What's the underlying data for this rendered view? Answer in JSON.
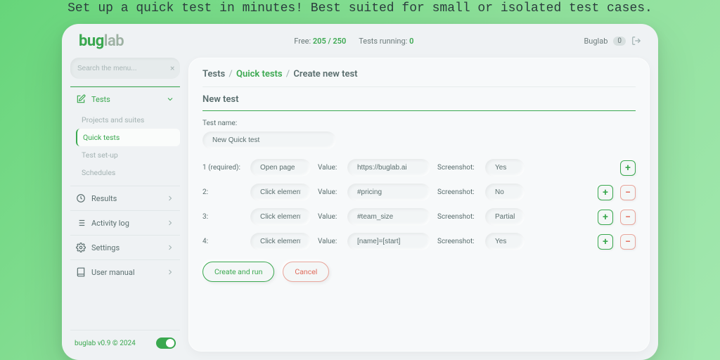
{
  "tagline": "Set up a quick test in minutes! Best suited for small or isolated test cases.",
  "logo": {
    "part1": "bug",
    "part2": "lab"
  },
  "header": {
    "free_label": "Free:",
    "free_value": "205 / 250",
    "running_label": "Tests running:",
    "running_value": "0",
    "user_name": "Buglab",
    "user_count": "0"
  },
  "search": {
    "placeholder": "Search the menu..."
  },
  "menu": {
    "tests": {
      "label": "Tests",
      "sub": [
        "Projects and suites",
        "Quick tests",
        "Test set-up",
        "Schedules"
      ],
      "selected": 1
    },
    "results": "Results",
    "activity": "Activity log",
    "settings": "Settings",
    "manual": "User manual"
  },
  "footer": {
    "text": "buglab v0.9 © 2024"
  },
  "breadcrumb": {
    "a": "Tests",
    "b": "Quick tests",
    "c": "Create new test"
  },
  "panel": {
    "title": "New test",
    "name_label": "Test name:",
    "name_value": "New Quick test",
    "value_label": "Value:",
    "screenshot_label": "Screenshot:",
    "steps": [
      {
        "idx": "1 (required):",
        "action": "Open page",
        "value": "https://buglab.ai",
        "screenshot": "Yes",
        "add": true,
        "remove": false
      },
      {
        "idx": "2:",
        "action": "Click element",
        "value": "#pricing",
        "screenshot": "No",
        "add": true,
        "remove": true
      },
      {
        "idx": "3:",
        "action": "Click element",
        "value": "#team_size",
        "screenshot": "Partial",
        "add": true,
        "remove": true
      },
      {
        "idx": "4:",
        "action": "Click element",
        "value": "[name]=[start]",
        "screenshot": "Yes",
        "add": true,
        "remove": true
      }
    ],
    "create_btn": "Create and run",
    "cancel_btn": "Cancel"
  }
}
